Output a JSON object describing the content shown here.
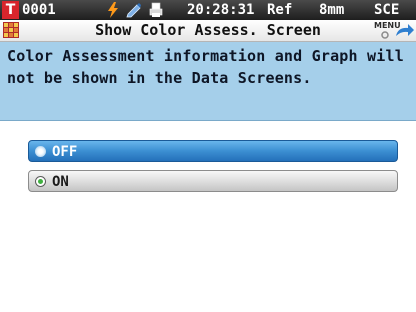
{
  "statusbar": {
    "badge": "T",
    "number": "0001",
    "time": "20:28:31",
    "ref": "Ref",
    "size": "8mm",
    "mode": "SCE",
    "icons": [
      "lightning-icon",
      "pen-icon",
      "printer-icon"
    ]
  },
  "titlebar": {
    "title": "Show Color Assess. Screen",
    "menu_label": "MENU"
  },
  "description": "Color Assessment information and Graph will not be shown in the Data Screens.",
  "options": [
    {
      "label": "OFF",
      "selected": true
    },
    {
      "label": "ON",
      "selected": false
    }
  ],
  "colors": {
    "accent": "#3c8fd2",
    "description_bg": "#a5cfea",
    "badge_red": "#d8252c"
  }
}
